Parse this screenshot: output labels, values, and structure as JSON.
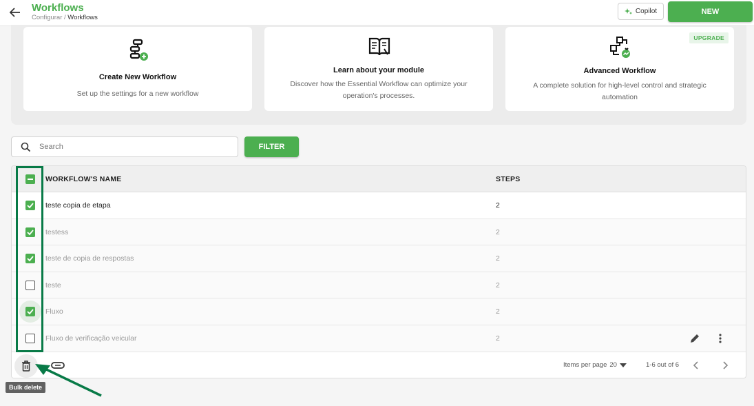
{
  "header": {
    "title": "Workflows",
    "breadcrumb_parent": "Configurar",
    "breadcrumb_sep": " / ",
    "breadcrumb_current": "Workflows",
    "copilot_label": "Copilot",
    "new_label": "NEW"
  },
  "cards": [
    {
      "title": "Create New Workflow",
      "description": "Set up the settings for a new workflow",
      "icon": "workflow-add-icon"
    },
    {
      "title": "Learn about your module",
      "description": "Discover how the Essential Workflow can optimize your operation's processes.",
      "icon": "book-icon"
    },
    {
      "title": "Advanced Workflow",
      "description": "A complete solution for high-level control and strategic automation",
      "icon": "advanced-workflow-icon",
      "badge": "UPGRADE"
    }
  ],
  "search": {
    "placeholder": "Search",
    "value": ""
  },
  "filter_label": "FILTER",
  "table": {
    "columns": [
      "WORKFLOW'S NAME",
      "STEPS"
    ],
    "rows": [
      {
        "name": "teste copia de etapa",
        "steps": "2",
        "checked": true
      },
      {
        "name": "testess",
        "steps": "2",
        "checked": true
      },
      {
        "name": "teste de copia de respostas",
        "steps": "2",
        "checked": true
      },
      {
        "name": "teste",
        "steps": "2",
        "checked": false
      },
      {
        "name": "Fluxo",
        "steps": "2",
        "checked": true
      },
      {
        "name": "Fluxo de verificação veicular",
        "steps": "2",
        "checked": false
      }
    ]
  },
  "footer": {
    "items_per_page_label": "Items per page",
    "items_per_page_value": "20",
    "range_label": "1-6 out of 6"
  },
  "tooltip": "Bulk delete",
  "colors": {
    "brand": "#4caf50",
    "annotation": "#087a47"
  }
}
